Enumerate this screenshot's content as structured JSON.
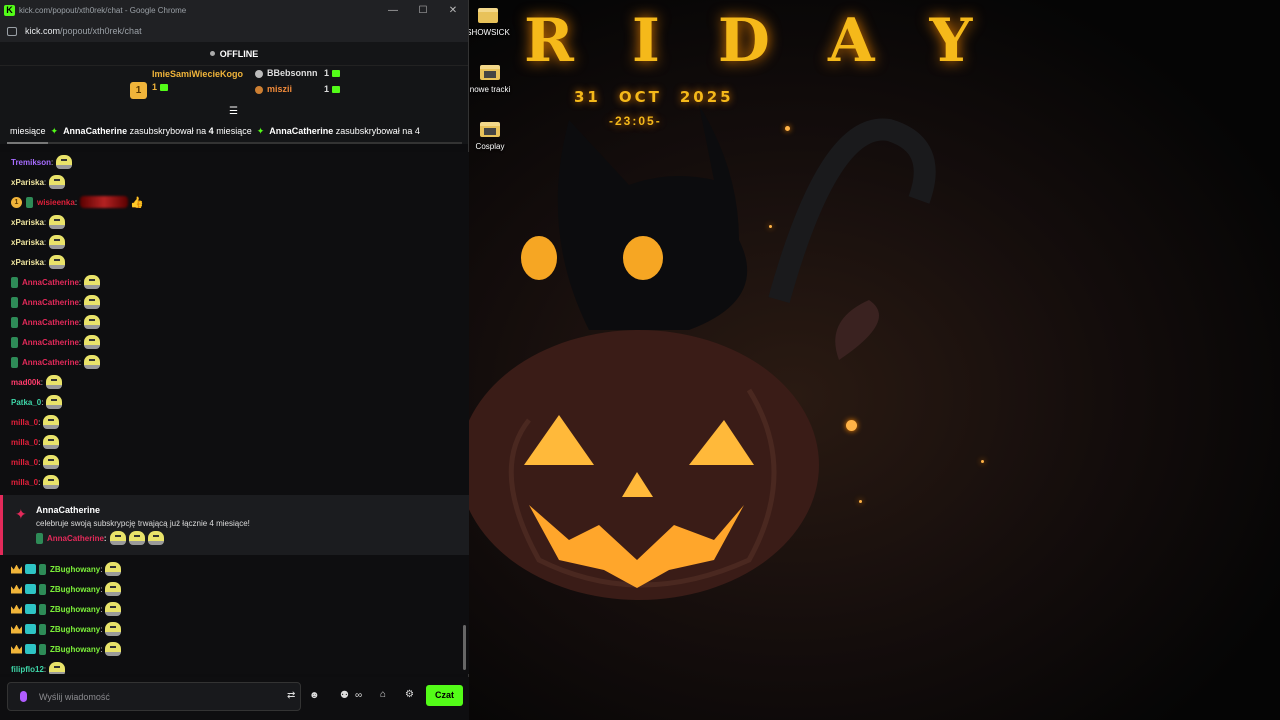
{
  "window": {
    "title": "kick.com/popout/xth0rek/chat - Google Chrome",
    "controls": [
      "—",
      "☐",
      "✕"
    ]
  },
  "address": {
    "host": "kick.com",
    "path": "/popout/xth0rek/chat"
  },
  "stream_status": "OFFLINE",
  "leaderboard": [
    {
      "rank": "1",
      "name": "ImieSamiWiecieKogo",
      "count": "1"
    },
    {
      "name": "BBebsonnn",
      "count": "1"
    },
    {
      "name": "miszii",
      "count": "1"
    }
  ],
  "marquee": {
    "text1": "miesiące",
    "sub_name": "AnnaCatherine",
    "sub_text": "zasubskrybował na",
    "sub_months": "4",
    "sub_unit": "miesiące",
    "sub_tail": "zasubskrybował na 4"
  },
  "colors": {
    "kick_green": "#53fc18",
    "sub_accent": "#e32a5a"
  },
  "chat": [
    {
      "user": "Tremikson",
      "color": "#a66cff",
      "badges": []
    },
    {
      "user": "xPariska",
      "color": "#f0e6a0",
      "badges": []
    },
    {
      "user": "wisieenka",
      "color": "#e0203a",
      "badges": [
        "num",
        "ticket"
      ],
      "blur": true
    },
    {
      "user": "xPariska",
      "color": "#f0e6a0",
      "badges": []
    },
    {
      "user": "xPariska",
      "color": "#f0e6a0",
      "badges": []
    },
    {
      "user": "xPariska",
      "color": "#f0e6a0",
      "badges": []
    },
    {
      "user": "AnnaCatherine",
      "color": "#e32a5a",
      "badges": [
        "ticket"
      ]
    },
    {
      "user": "AnnaCatherine",
      "color": "#e32a5a",
      "badges": [
        "ticket"
      ]
    },
    {
      "user": "AnnaCatherine",
      "color": "#e32a5a",
      "badges": [
        "ticket"
      ]
    },
    {
      "user": "AnnaCatherine",
      "color": "#e32a5a",
      "badges": [
        "ticket"
      ]
    },
    {
      "user": "AnnaCatherine",
      "color": "#e32a5a",
      "badges": [
        "ticket"
      ]
    },
    {
      "user": "mad00k",
      "color": "#ff3b6b",
      "badges": []
    },
    {
      "user": "Patka_0",
      "color": "#3ed6a8",
      "badges": []
    },
    {
      "user": "milla_0",
      "color": "#e0203a",
      "badges": []
    },
    {
      "user": "milla_0",
      "color": "#e0203a",
      "badges": []
    },
    {
      "user": "milla_0",
      "color": "#e0203a",
      "badges": []
    },
    {
      "user": "milla_0",
      "color": "#e0203a",
      "badges": []
    }
  ],
  "sub_event": {
    "name": "AnnaCatherine",
    "text": "celebruje swoją subskrypcję trwającą już łącznie 4 miesiące!",
    "user": "AnnaCatherine"
  },
  "chat2": [
    {
      "user": "ZBughowany",
      "color": "#7cf03a"
    },
    {
      "user": "ZBughowany",
      "color": "#7cf03a"
    },
    {
      "user": "ZBughowany",
      "color": "#7cf03a"
    },
    {
      "user": "ZBughowany",
      "color": "#7cf03a"
    },
    {
      "user": "ZBughowany",
      "color": "#7cf03a"
    }
  ],
  "last": {
    "user": "filipflo12",
    "color": "#3ed6a8"
  },
  "input": {
    "placeholder": "Wyślij wiadomość"
  },
  "send_label": "Czat",
  "wallpaper": {
    "title": "RIDAY",
    "date": [
      "31",
      "OCT",
      "2025"
    ],
    "time": "-23:05-"
  },
  "desktop_icons": [
    "SHOWSICK",
    "nowe tracki",
    "Cosplay"
  ]
}
